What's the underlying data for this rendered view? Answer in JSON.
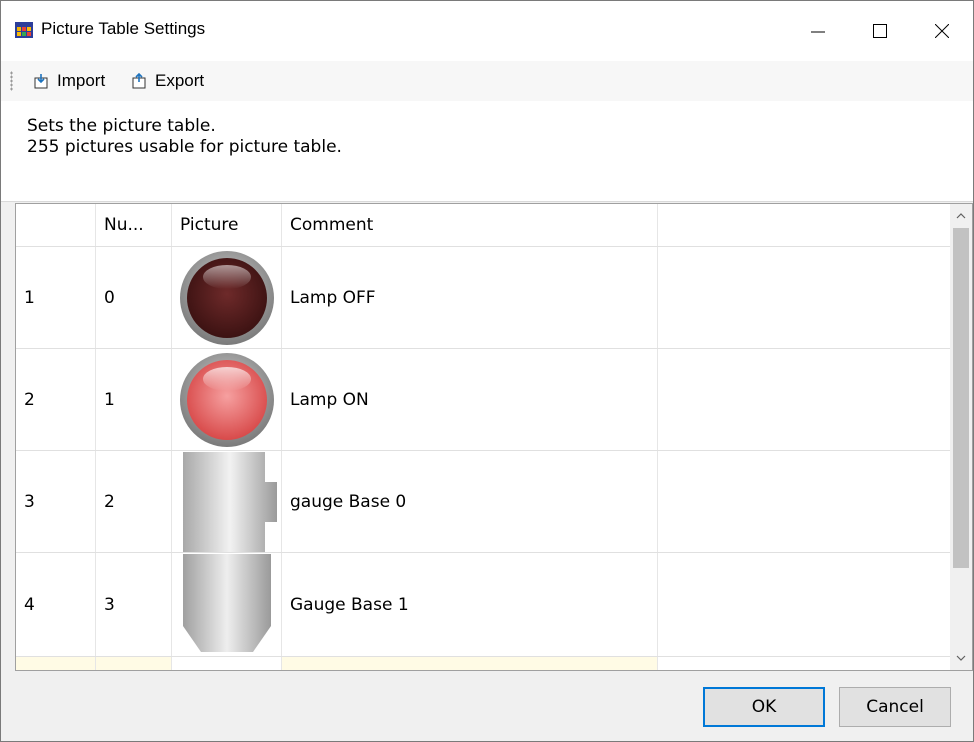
{
  "window": {
    "title": "Picture Table Settings",
    "icon": "table-icon"
  },
  "toolbar": {
    "import_label": "Import",
    "export_label": "Export"
  },
  "description": {
    "line1": "Sets the picture table.",
    "line2": "255 pictures usable for picture table."
  },
  "table": {
    "headers": [
      "",
      "Nu...",
      "Picture",
      "Comment"
    ],
    "rows": [
      {
        "index": "1",
        "number": "0",
        "picture": "lamp-off-picture",
        "comment": "Lamp OFF"
      },
      {
        "index": "2",
        "number": "1",
        "picture": "lamp-on-picture",
        "comment": "Lamp ON"
      },
      {
        "index": "3",
        "number": "2",
        "picture": "gauge-base-0-picture",
        "comment": "gauge Base 0"
      },
      {
        "index": "4",
        "number": "3",
        "picture": "gauge-base-1-picture",
        "comment": "Gauge Base 1"
      }
    ]
  },
  "buttons": {
    "ok": "OK",
    "cancel": "Cancel"
  },
  "colors": {
    "new_row": "#fffbe5",
    "accent": "#0078d7"
  }
}
